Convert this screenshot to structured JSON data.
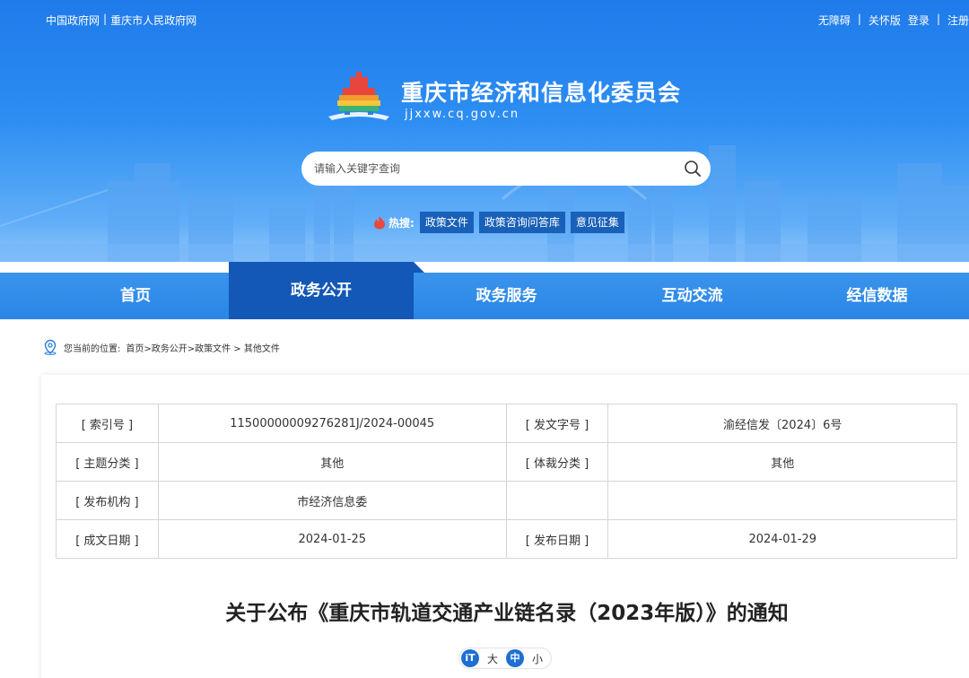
{
  "topbar": {
    "left_links": [
      "中国政府网",
      "重庆市人民政府网"
    ],
    "right_links": [
      "无障碍",
      "关怀版",
      "登录",
      "注册"
    ]
  },
  "site": {
    "name": "重庆市经济和信息化委员会",
    "domain": "jjxxw.cq.gov.cn"
  },
  "search": {
    "placeholder": "请输入关键字查询"
  },
  "hot_search": {
    "label": "热搜:",
    "tags": [
      "政策文件",
      "政策咨询问答库",
      "意见征集"
    ]
  },
  "nav": {
    "items": [
      "首页",
      "政务公开",
      "政务服务",
      "互动交流",
      "经信数据"
    ],
    "active": "政务公开"
  },
  "breadcrumb": {
    "prefix": "您当前的位置:",
    "path": "首页>政务公开>政策文件 > 其他文件"
  },
  "meta_table": {
    "rows": [
      [
        "[ 索引号 ]",
        "11500000009276281J/2024-00045",
        "[ 发文字号 ]",
        "渝经信发〔2024〕6号"
      ],
      [
        "[ 主题分类 ]",
        "其他",
        "[ 体裁分类 ]",
        "其他"
      ],
      [
        "[ 发布机构 ]",
        "市经济信息委",
        "",
        ""
      ],
      [
        "[ 成文日期 ]",
        "2024-01-25",
        "[ 发布日期 ]",
        "2024-01-29"
      ]
    ]
  },
  "document": {
    "title": "关于公布《重庆市轨道交通产业链名录（2023年版）》的通知"
  },
  "font_size": {
    "icon_label": "iT",
    "options": [
      "大",
      "中",
      "小"
    ],
    "selected": "中"
  },
  "colors": {
    "banner_top": "#1f7bea",
    "nav": "#2a86e6",
    "nav_active": "#1358b6",
    "hot_tag": "#1960b8"
  }
}
